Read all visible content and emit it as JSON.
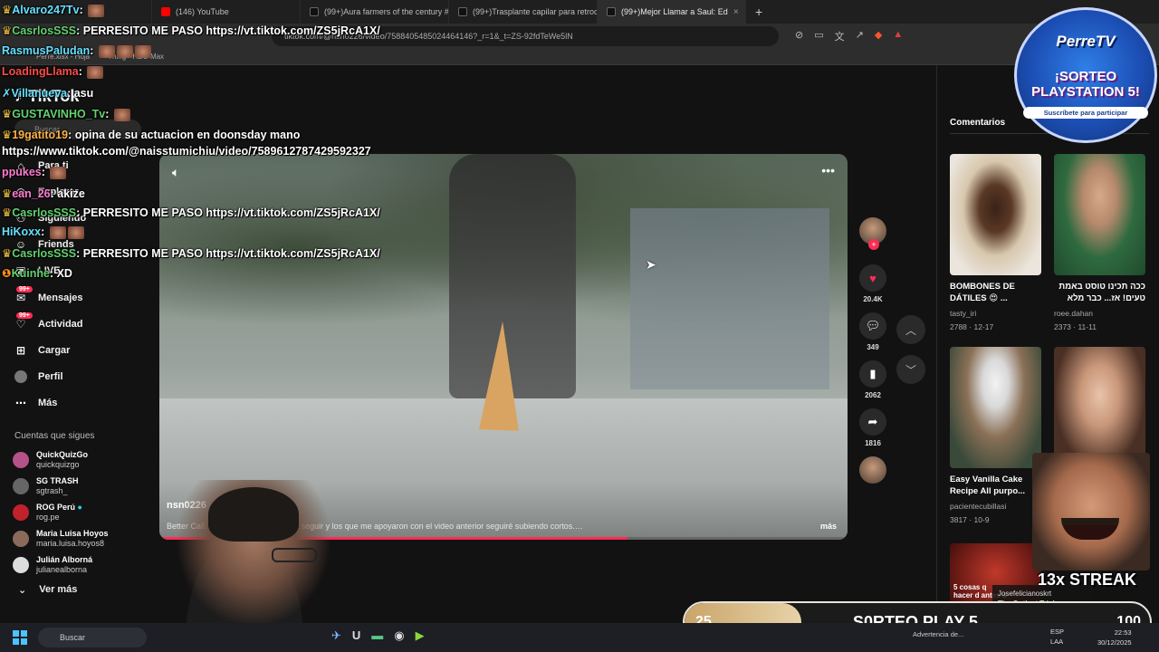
{
  "browser": {
    "tabs": [
      {
        "label": "(146) YouTube",
        "color": "#ff0000"
      },
      {
        "label": "(99+)Aura farmers of the century #a",
        "color": "#222222"
      },
      {
        "label": "(99+)Trasplante capilar para retroce",
        "color": "#222222"
      },
      {
        "label": "(99+)Mejor Llamar a Saul: Ed",
        "color": "#222222"
      }
    ],
    "new_tab": "+",
    "tab_close": "×",
    "url": "tiktok.com/@nsn0226/video/7588405485024464146?_r=1&_t=ZS-92fdTeWe5lN",
    "bookmarks": [
      "Perre.xlsx - Hoja",
      "Thing • HBO Max"
    ]
  },
  "tiktok": {
    "logo": "TikTok",
    "search_placeholder": "Buscar",
    "nav": [
      {
        "label": "Para ti",
        "icon": "home-icon"
      },
      {
        "label": "Explorar",
        "icon": "compass-icon"
      },
      {
        "label": "Siguiendo",
        "icon": "following-icon"
      },
      {
        "label": "Friends",
        "icon": "friends-icon"
      },
      {
        "label": "LIVE",
        "icon": "live-icon"
      },
      {
        "label": "Mensajes",
        "icon": "messages-icon",
        "badge": "99+"
      },
      {
        "label": "Actividad",
        "icon": "activity-icon",
        "badge": "99+"
      },
      {
        "label": "Cargar",
        "icon": "upload-icon"
      },
      {
        "label": "Perfil",
        "icon": "profile-icon"
      },
      {
        "label": "Más",
        "icon": "more-icon"
      }
    ],
    "following_title": "Cuentas que sigues",
    "following": [
      {
        "name": "QuickQuizGo",
        "handle": "quickquizgo",
        "color": "#b5528a"
      },
      {
        "name": "SG TRASH",
        "handle": "sgtrash_",
        "color": "#666666"
      },
      {
        "name": "ROG Perú",
        "handle": "rog.pe",
        "color": "#c0212b",
        "verified": true
      },
      {
        "name": "Maria Luisa Hoyos",
        "handle": "maria.luisa.hoyos8",
        "color": "#8a6a5a"
      },
      {
        "name": "Julián Alborná",
        "handle": "julianealborna",
        "color": "#dddddd"
      }
    ],
    "see_more": "Ver más",
    "video": {
      "author": "nsn0226",
      "caption": "Better Call… o que me emperazon a seguir y los que me apoyaron con el video anterior seguiré subiendo cortos.…",
      "more": "más",
      "progress": 0.68
    },
    "actions": {
      "likes": "20.4K",
      "comments": "349",
      "saves": "2062",
      "shares": "1816"
    },
    "right_tab": "Comentarios",
    "recommended": [
      {
        "title": "BOMBONES DE DÁTILES 😍 ...",
        "user": "tasty_iri",
        "stats": "2788 · 12-17"
      },
      {
        "title": "ככה תכינו טוסט באמת טעים! אז... כבר מלא",
        "user": "roee.dahan",
        "stats": "2373 · 11-11"
      },
      {
        "title": "Easy Vanilla Cake Recipe All purpo...",
        "user": "pacientecubillasi",
        "stats": "3817 · 10-9"
      },
      {
        "title": "",
        "user": "",
        "stats": ""
      },
      {
        "title": "5 cosas q hacer d antes d",
        "user": "",
        "stats": ""
      }
    ]
  },
  "stream": {
    "chat": [
      {
        "user": "Alvaro247Tv",
        "msg": "",
        "color": "cyan"
      },
      {
        "user": "CasrlosSSS",
        "msg": "PERRESITO ME PASO https://vt.tiktok.com/ZS5jRcA1X/",
        "color": "green"
      },
      {
        "user": "RasmusPaludan",
        "msg": "",
        "color": "cyan"
      },
      {
        "user": "LoadingLlama",
        "msg": "",
        "color": "red"
      },
      {
        "user": "Villanueva",
        "msg": "asu",
        "color": "cyan"
      },
      {
        "user": "GUSTAVINHO_Tv",
        "msg": "",
        "color": "green"
      },
      {
        "user": "19gatito19",
        "msg": "opina de su actuacion en doonsday mano",
        "color": "orange"
      },
      {
        "user": "",
        "msg": "https://www.tiktok.com/@naisstumichiu/video/7589612787429592327",
        "color": "cyan"
      },
      {
        "user": "ppukes",
        "msg": "",
        "color": "pink"
      },
      {
        "user": "ean_26",
        "msg": "akize",
        "color": "pink"
      },
      {
        "user": "CasrlosSSS",
        "msg": "PERRESITO ME PASO https://vt.tiktok.com/ZS5jRcA1X/",
        "color": "green"
      },
      {
        "user": "HiKoxx",
        "msg": "",
        "color": "cyan"
      },
      {
        "user": "CasrlosSSS",
        "msg": "PERRESITO ME PASO https://vt.tiktok.com/ZS5jRcA1X/",
        "color": "green"
      },
      {
        "user": "Kuinhe",
        "msg": "XD",
        "color": "green"
      }
    ],
    "perretv": {
      "brand": "PerreTV",
      "headline": "¡SORTEO PLAYSTATION 5!",
      "cta": "Suscríbete para participar"
    },
    "streak": "13x STREAK",
    "alert": {
      "name": "Josefelicianoskrt",
      "sub": "The Outlast Trials"
    },
    "goal": {
      "current": "25",
      "label": "S0RTEO PLAY 5",
      "target": "100",
      "progress": 0.25
    }
  },
  "taskbar": {
    "search": "Buscar",
    "lang": "ESP",
    "lang2": "LAA",
    "time": "22:53",
    "date": "30/12/2025",
    "notif": "Advertencia de..."
  }
}
